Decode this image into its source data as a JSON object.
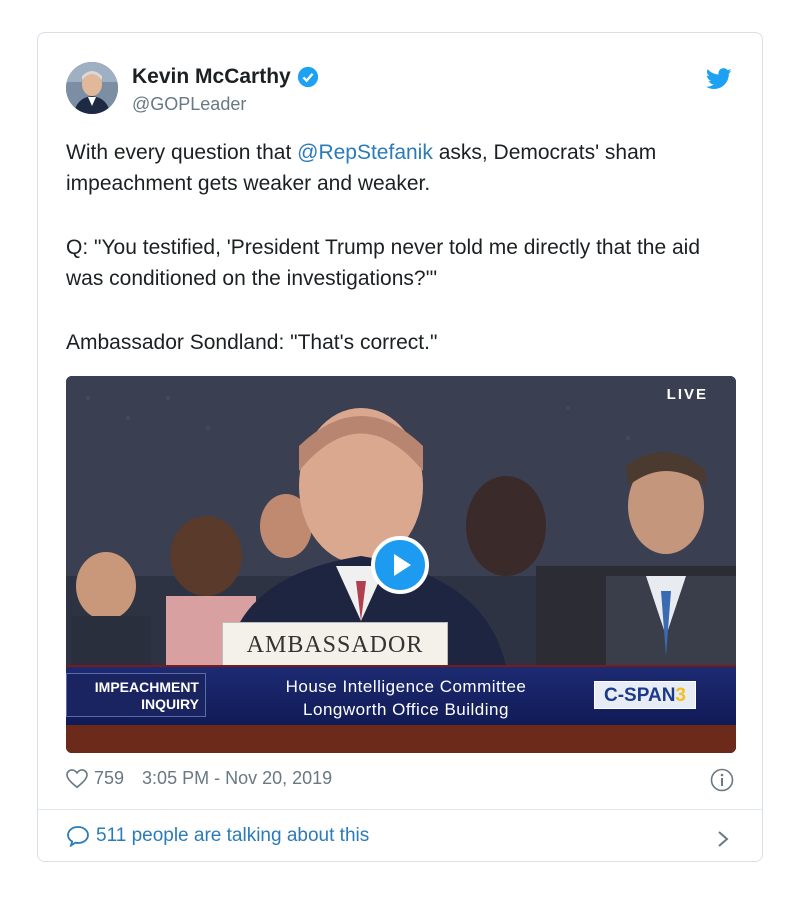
{
  "tweet": {
    "author_name": "Kevin McCarthy",
    "handle": "@GOPLeader",
    "text_part1": "With every question that ",
    "mention": "@RepStefanik",
    "text_part2": " asks, Democrats' sham impeachment gets weaker and weaker.",
    "quote": "Q: \"You testified, 'President Trump never told me directly that the aid was conditioned on the investigations?'\"",
    "answer": "Ambassador Sondland: \"That's correct.\"",
    "likes": "759",
    "timestamp": "3:05 PM - Nov 20, 2019",
    "talking": "511 people are talking about this"
  },
  "video": {
    "live_label": "LIVE",
    "placard": "AMBASSADOR",
    "lower_third_left_line1": "IMPEACHMENT",
    "lower_third_left_line2": "INQUIRY",
    "lower_third_line1": "House Intelligence Committee",
    "lower_third_line2": "Longworth Office Building",
    "network": "C-SPAN",
    "network_number": "3"
  },
  "colors": {
    "link": "#2b7bb9",
    "verified": "#1da1f2",
    "muted": "#697882"
  },
  "icons": [
    "verified-badge-icon",
    "twitter-bird-icon",
    "play-icon",
    "heart-icon",
    "info-icon",
    "speech-bubble-icon",
    "chevron-right-icon"
  ]
}
